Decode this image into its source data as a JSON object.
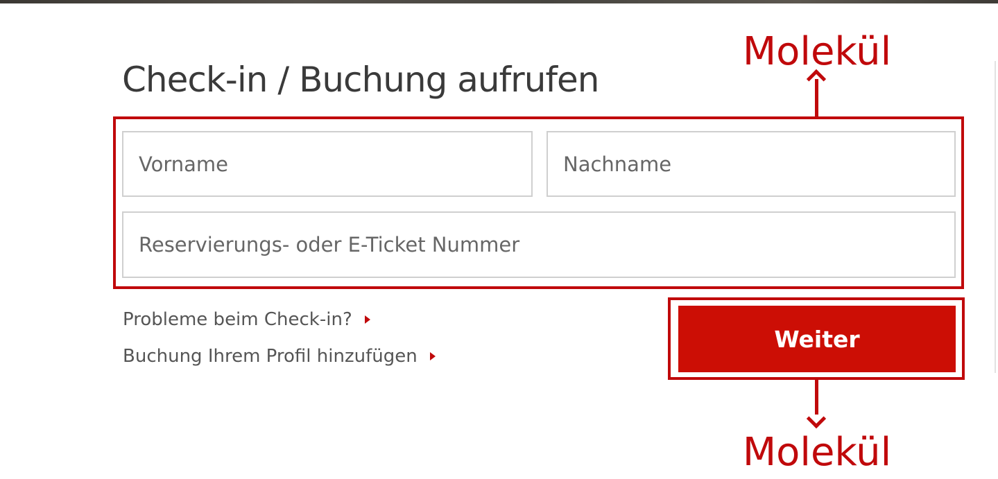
{
  "page": {
    "title": "Check-in / Buchung aufrufen"
  },
  "form": {
    "first_name_placeholder": "Vorname",
    "last_name_placeholder": "Nachname",
    "booking_number_placeholder": "Reservierungs- oder E-Ticket Nummer",
    "submit_label": "Weiter"
  },
  "links": {
    "checkin_problems": "Probleme beim Check-in?",
    "add_booking_to_profile": "Buchung Ihrem Profil hinzufügen"
  },
  "annotations": {
    "form_label": "Molekül",
    "button_label": "Molekül"
  },
  "colors": {
    "accent": "#cc0e05",
    "annotation": "#c0090b",
    "text": "#3a3a3a",
    "field_border": "#cfcfcf"
  }
}
